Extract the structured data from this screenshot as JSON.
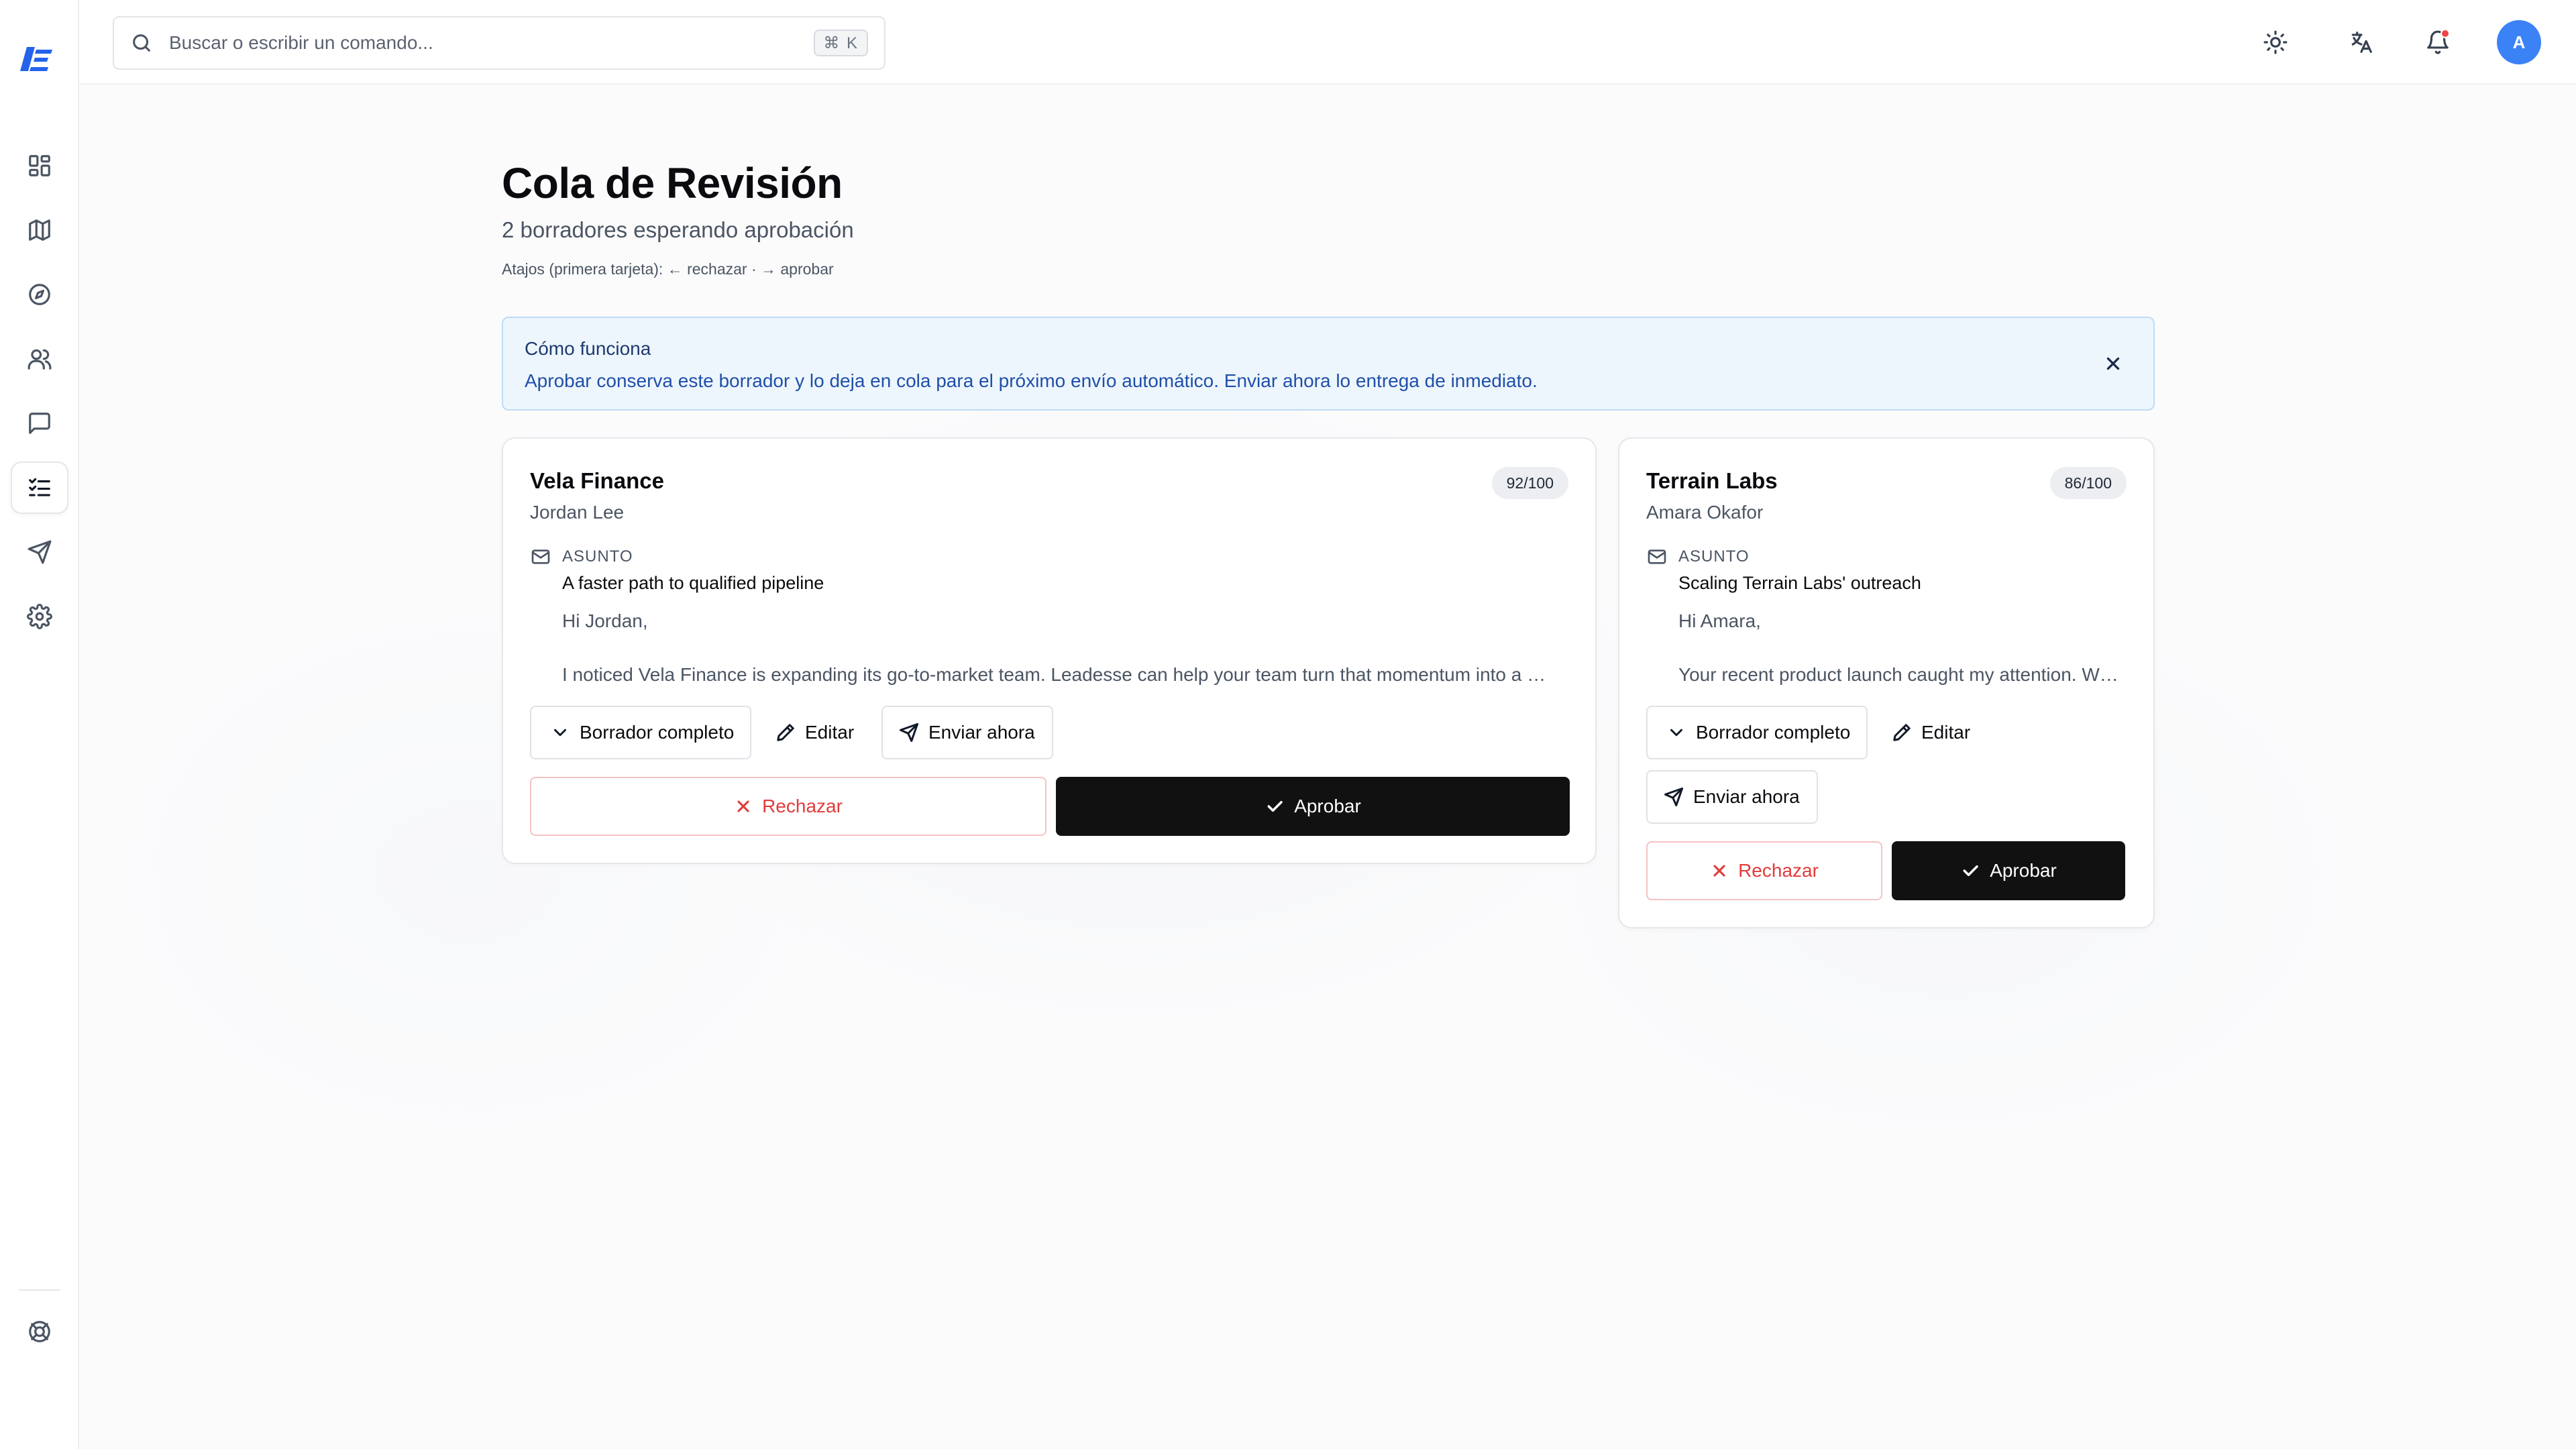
{
  "search": {
    "placeholder": "Buscar o escribir un comando...",
    "shortcut": "⌘ K"
  },
  "sidebar": {
    "items": [
      {
        "icon": "dashboard-icon"
      },
      {
        "icon": "map-icon"
      },
      {
        "icon": "compass-icon"
      },
      {
        "icon": "users-icon"
      },
      {
        "icon": "message-icon"
      },
      {
        "icon": "review-list-icon",
        "active": true
      },
      {
        "icon": "send-icon"
      },
      {
        "icon": "settings-icon"
      },
      {
        "icon": "help-lifebuoy-icon"
      }
    ]
  },
  "topbar": {
    "avatar_initial": "A"
  },
  "page": {
    "title": "Cola de Revisión",
    "subtitle": "2 borradores esperando aprobación",
    "shortcuts": "Atajos (primera tarjeta): ← rechazar · → aprobar"
  },
  "info": {
    "title": "Cómo funciona",
    "text": "Aprobar conserva este borrador y lo deja en cola para el próximo envío automático. Enviar ahora lo entrega de inmediato."
  },
  "labels": {
    "subject": "ASUNTO",
    "full_draft": "Borrador completo",
    "edit": "Editar",
    "send_now": "Enviar ahora",
    "reject": "Rechazar",
    "approve": "Aprobar"
  },
  "drafts": [
    {
      "company": "Vela Finance",
      "contact": "Jordan Lee",
      "score": "92/100",
      "subject": "A faster path to qualified pipeline",
      "greeting": "Hi Jordan,",
      "preview": "I noticed Vela Finance is expanding its go-to-market team. Leadesse can help your team turn that momentum into a …"
    },
    {
      "company": "Terrain Labs",
      "contact": "Amara Okafor",
      "score": "86/100",
      "subject": "Scaling Terrain Labs' outreach",
      "greeting": "Hi Amara,",
      "preview": "Your recent product launch caught my attention. W…"
    }
  ],
  "colors": {
    "accent": "#2563eb",
    "approve": "#111111",
    "reject": "#e23b3b",
    "info_bg": "#eef6fd"
  }
}
